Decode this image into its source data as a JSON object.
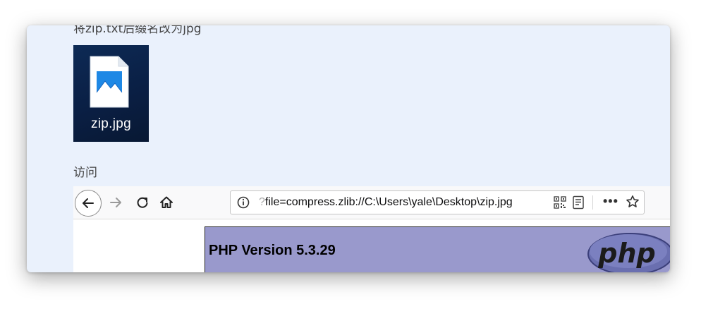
{
  "doc": {
    "cut_text": "将zip.txt后缀名改为jpg",
    "file_label": "zip.jpg",
    "file_icon": "image-file-icon",
    "visit_label": "访问"
  },
  "browser": {
    "url_prefix": "?",
    "url_text": "file=compress.zlib://C:\\Users\\yale\\Desktop\\zip.jpg",
    "more_label": "•••",
    "icons": [
      "back-icon",
      "forward-icon",
      "reload-icon",
      "home-icon",
      "info-icon",
      "qr-code-icon",
      "reader-view-icon",
      "more-icon",
      "bookmark-star-icon"
    ]
  },
  "page": {
    "php_version": "PHP Version 5.3.29",
    "logo_text": "php",
    "banner_color": "#9999cc"
  }
}
